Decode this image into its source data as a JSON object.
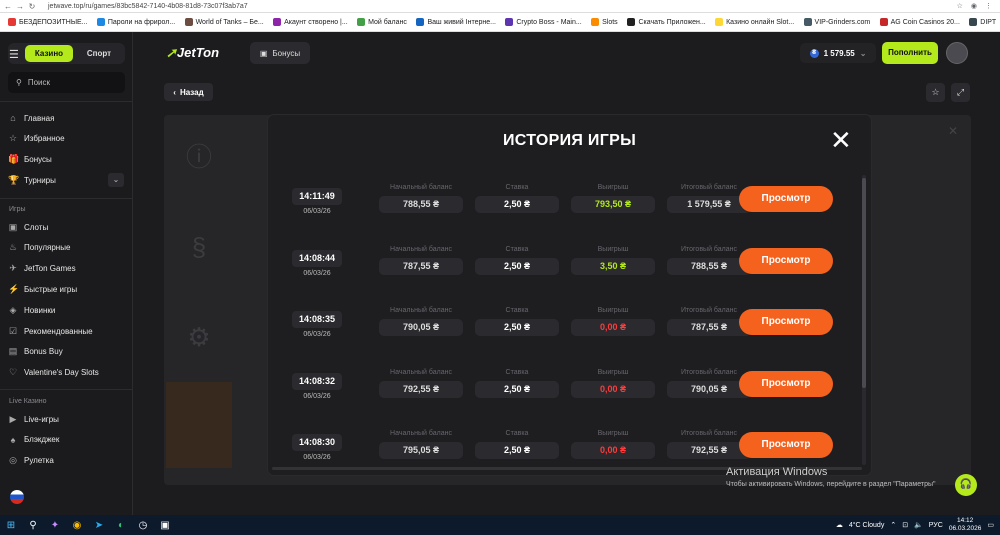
{
  "browser": {
    "url": "jetwave.top/ru/games/83bc5842-7140-4b08-81d8-73c07f3ab7a7",
    "bookmarks": [
      {
        "label": "БЕЗДЕПОЗИТНЫЕ...",
        "color": "#e53935"
      },
      {
        "label": "Пароли на фрирол...",
        "color": "#1e88e5"
      },
      {
        "label": "World of Tanks – Бе...",
        "color": "#6d4c41"
      },
      {
        "label": "Акаунт створено |...",
        "color": "#8e24aa"
      },
      {
        "label": "Мой баланс",
        "color": "#43a047"
      },
      {
        "label": "Ваш живий Інтерне...",
        "color": "#1565c0"
      },
      {
        "label": "Crypto Boss - Main...",
        "color": "#5e35b1"
      },
      {
        "label": "Slots",
        "color": "#fb8c00"
      },
      {
        "label": "Скачать Приложен...",
        "color": "#212121"
      },
      {
        "label": "Казино онлайн Slot...",
        "color": "#fdd835"
      },
      {
        "label": "VIP-Grinders.com",
        "color": "#455a64"
      },
      {
        "label": "AG Coin Casinos 20...",
        "color": "#c62828"
      },
      {
        "label": "DIPT",
        "color": "#37474f"
      }
    ]
  },
  "sidebar": {
    "tabs": {
      "casino": "Казино",
      "sport": "Спорт"
    },
    "search_placeholder": "Поиск",
    "main_items": [
      {
        "label": "Главная",
        "icon": "home-icon",
        "glyph": "⌂"
      },
      {
        "label": "Избранное",
        "icon": "star-icon",
        "glyph": "☆"
      },
      {
        "label": "Бонусы",
        "icon": "gift-icon",
        "glyph": "🎁"
      },
      {
        "label": "Турниры",
        "icon": "trophy-icon",
        "glyph": "🏆"
      }
    ],
    "games_header": "Игры",
    "games_items": [
      {
        "label": "Слоты",
        "icon": "slot-icon",
        "glyph": "▣"
      },
      {
        "label": "Популярные",
        "icon": "fire-icon",
        "glyph": "♨"
      },
      {
        "label": "JetTon Games",
        "icon": "jet-icon",
        "glyph": "✈"
      },
      {
        "label": "Быстрые игры",
        "icon": "flash-icon",
        "glyph": "⚡"
      },
      {
        "label": "Новинки",
        "icon": "new-icon",
        "glyph": "◈"
      },
      {
        "label": "Рекомендованные",
        "icon": "thumb-icon",
        "glyph": "☑"
      },
      {
        "label": "Bonus Buy",
        "icon": "cart-icon",
        "glyph": "▤"
      },
      {
        "label": "Valentine's Day Slots",
        "icon": "heart-icon",
        "glyph": "♡"
      }
    ],
    "live_header": "Live Казино",
    "live_items": [
      {
        "label": "Live-игры",
        "icon": "live-icon",
        "glyph": "▶"
      },
      {
        "label": "Блэкджек",
        "icon": "cards-icon",
        "glyph": "♠"
      },
      {
        "label": "Рулетка",
        "icon": "roulette-icon",
        "glyph": "◎"
      }
    ]
  },
  "header": {
    "logo_a": "Jet",
    "logo_b": "Ton",
    "bonus_label": "Бонусы",
    "balance": "1 579.55",
    "topup_label": "Пополнить"
  },
  "game": {
    "back_label": "Назад"
  },
  "modal": {
    "title": "ИСТОРИЯ ИГРЫ",
    "labels": {
      "start": "Начальный баланс",
      "bet": "Ставка",
      "win": "Выигрыш",
      "final": "Итоговый баланс",
      "view": "Просмотр"
    },
    "win_colors": {
      "positive": "#b4ea1c",
      "zero": "#ff3b3b"
    },
    "rows": [
      {
        "time": "14:11:49",
        "date": "06/03/26",
        "start": "788,55 ₴",
        "bet": "2,50 ₴",
        "win": "793,50 ₴",
        "win_type": "positive",
        "final": "1 579,55 ₴"
      },
      {
        "time": "14:08:44",
        "date": "06/03/26",
        "start": "787,55 ₴",
        "bet": "2,50 ₴",
        "win": "3,50 ₴",
        "win_type": "positive",
        "final": "788,55 ₴"
      },
      {
        "time": "14:08:35",
        "date": "06/03/26",
        "start": "790,05 ₴",
        "bet": "2,50 ₴",
        "win": "0,00 ₴",
        "win_type": "zero",
        "final": "787,55 ₴"
      },
      {
        "time": "14:08:32",
        "date": "06/03/26",
        "start": "792,55 ₴",
        "bet": "2,50 ₴",
        "win": "0,00 ₴",
        "win_type": "zero",
        "final": "790,05 ₴"
      },
      {
        "time": "14:08:30",
        "date": "06/03/26",
        "start": "795,05 ₴",
        "bet": "2,50 ₴",
        "win": "0,00 ₴",
        "win_type": "zero",
        "final": "792,55 ₴"
      }
    ]
  },
  "windows": {
    "activate_title": "Активация Windows",
    "activate_text": "Чтобы активировать Windows, перейдите в раздел \"Параметры\"",
    "weather": "4°C  Cloudy",
    "lang": "РУС",
    "time": "14:12",
    "date": "06.03.2026"
  }
}
